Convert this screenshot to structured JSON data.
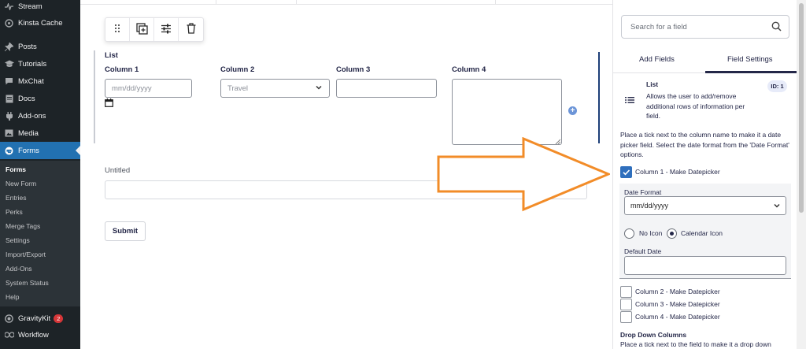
{
  "sidebar": {
    "items": [
      {
        "label": "Stream",
        "icon": "stream-icon"
      },
      {
        "label": "Kinsta Cache",
        "icon": "kinsta-icon"
      },
      {
        "label": "Posts",
        "icon": "pin-icon"
      },
      {
        "label": "Tutorials",
        "icon": "graduation-cap-icon"
      },
      {
        "label": "MxChat",
        "icon": "chat-icon"
      },
      {
        "label": "Docs",
        "icon": "docs-icon"
      },
      {
        "label": "Add-ons",
        "icon": "plugin-icon"
      },
      {
        "label": "Media",
        "icon": "media-icon"
      },
      {
        "label": "Forms",
        "icon": "gravity-forms-icon"
      }
    ],
    "submenu": [
      "Forms",
      "New Form",
      "Entries",
      "Perks",
      "Merge Tags",
      "Settings",
      "Import/Export",
      "Add-Ons",
      "System Status",
      "Help"
    ],
    "gravitykit": {
      "label": "GravityKit",
      "badge": "2"
    },
    "workflow": {
      "label": "Workflow"
    }
  },
  "toolbar": {
    "icons": [
      "drag-handle-icon",
      "duplicate-icon",
      "settings-sliders-icon",
      "trash-icon"
    ]
  },
  "list_field": {
    "label": "List",
    "columns": [
      "Column 1",
      "Column 2",
      "Column 3",
      "Column 4"
    ],
    "date_placeholder": "mm/dd/yyyy",
    "select_value": "Travel"
  },
  "untitled_field": {
    "label": "Untitled"
  },
  "submit": {
    "label": "Submit"
  },
  "panel": {
    "search_placeholder": "Search for a field",
    "tabs": [
      "Add Fields",
      "Field Settings"
    ],
    "field_name": "List",
    "field_description": "Allows the user to add/remove additional rows of information per field.",
    "id_badge": "ID: 1",
    "datepicker_help": "Place a tick next to the column name to make it a date picker field. Select the date format from the 'Date Format' options.",
    "col1_checkbox": "Column 1 - Make Datepicker",
    "date_format_label": "Date Format",
    "date_format_value": "mm/dd/yyyy",
    "radio_no_icon": "No Icon",
    "radio_calendar_icon": "Calendar Icon",
    "default_date_label": "Default Date",
    "col2_checkbox": "Column 2 - Make Datepicker",
    "col3_checkbox": "Column 3 - Make Datepicker",
    "col4_checkbox": "Column 4 - Make Datepicker",
    "dropdown_heading": "Drop Down Columns",
    "dropdown_help": "Place a tick next to the field to make it a drop down"
  },
  "colors": {
    "wp_sidebar": "#1d2327",
    "wp_active": "#2271b1",
    "accent_arrow": "#f28c28",
    "checkbox_on": "#2f6fbd",
    "field_text": "#242748"
  }
}
